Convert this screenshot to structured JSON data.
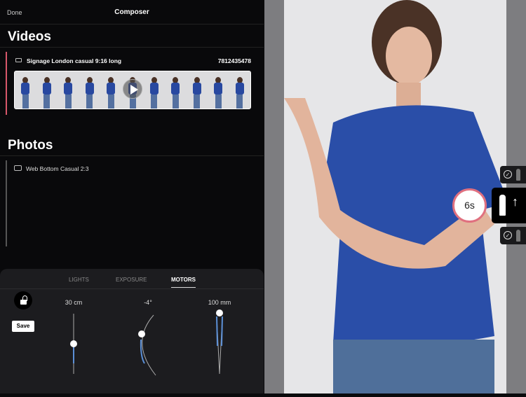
{
  "header": {
    "done": "Done",
    "title": "Composer"
  },
  "videos": {
    "heading": "Videos",
    "item": {
      "name": "Signage London casual 9:16 long",
      "id": "7812435478",
      "thumbnails": 11
    }
  },
  "photos": {
    "heading": "Photos",
    "item": {
      "name": "Web Bottom Casual 2:3"
    }
  },
  "panel": {
    "tabs": [
      "LIGHTS",
      "EXPOSURE",
      "MOTORS"
    ],
    "active_tab": "MOTORS",
    "save": "Save",
    "motors": [
      {
        "label": "30 cm",
        "fraction": 0.5
      },
      {
        "label": "-4°",
        "fraction": 0.6
      },
      {
        "label": "100 mm",
        "fraction": 1.0
      }
    ]
  },
  "preview": {
    "timer": "6s"
  },
  "colors": {
    "accent": "#d8576a",
    "slider": "#5b8fd6",
    "panel": "#1c1c1f"
  }
}
